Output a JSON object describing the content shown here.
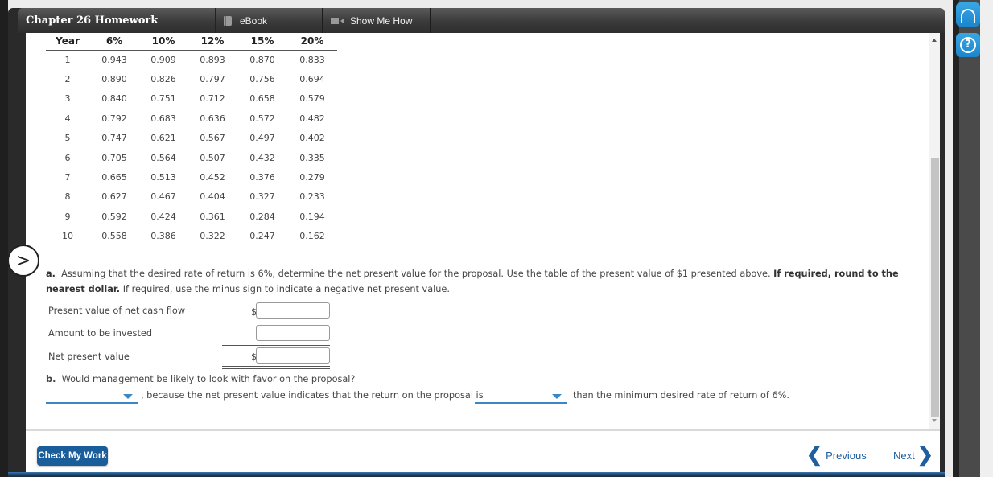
{
  "header": {
    "title": "Chapter 26 Homework",
    "tabs": [
      {
        "label": "eBook",
        "icon": "book-icon"
      },
      {
        "label": "Show Me How",
        "icon": "video-icon"
      }
    ]
  },
  "pv_table": {
    "headers": [
      "Year",
      "6%",
      "10%",
      "12%",
      "15%",
      "20%"
    ],
    "rows": [
      [
        "1",
        "0.943",
        "0.909",
        "0.893",
        "0.870",
        "0.833"
      ],
      [
        "2",
        "0.890",
        "0.826",
        "0.797",
        "0.756",
        "0.694"
      ],
      [
        "3",
        "0.840",
        "0.751",
        "0.712",
        "0.658",
        "0.579"
      ],
      [
        "4",
        "0.792",
        "0.683",
        "0.636",
        "0.572",
        "0.482"
      ],
      [
        "5",
        "0.747",
        "0.621",
        "0.567",
        "0.497",
        "0.402"
      ],
      [
        "6",
        "0.705",
        "0.564",
        "0.507",
        "0.432",
        "0.335"
      ],
      [
        "7",
        "0.665",
        "0.513",
        "0.452",
        "0.376",
        "0.279"
      ],
      [
        "8",
        "0.627",
        "0.467",
        "0.404",
        "0.327",
        "0.233"
      ],
      [
        "9",
        "0.592",
        "0.424",
        "0.361",
        "0.284",
        "0.194"
      ],
      [
        "10",
        "0.558",
        "0.386",
        "0.322",
        "0.247",
        "0.162"
      ]
    ]
  },
  "part_a": {
    "label": "a.",
    "text": "Assuming that the desired rate of return is 6%, determine the net present value for the proposal. Use the table of the present value of $1 presented above.",
    "bold_text": "If required, round to the nearest dollar.",
    "text_after": "If required, use the minus sign to indicate a negative net present value.",
    "rows": [
      {
        "label": "Present value of net cash flow",
        "prefix": "$",
        "value": ""
      },
      {
        "label": "Amount to be invested",
        "prefix": "",
        "value": ""
      },
      {
        "label": "Net present value",
        "prefix": "$",
        "value": ""
      }
    ]
  },
  "part_b": {
    "label": "b.",
    "question": "Would management be likely to look with favor on the proposal?",
    "middle_text": ", because the net present value indicates that the return on the proposal is",
    "end_text": "than the minimum desired rate of return of 6%.",
    "dropdown1_value": "",
    "dropdown2_value": ""
  },
  "footer": {
    "check_label": "Check My Work",
    "previous_label": "Previous",
    "next_label": "Next"
  },
  "side": {
    "support_icon": "headset-icon",
    "help_icon": "help-icon",
    "help_glyph": "?",
    "expand_glyph": ">"
  },
  "colors": {
    "accent": "#1a5d9b",
    "dropdown": "#3a87c8",
    "side_button": "#2196d8"
  }
}
